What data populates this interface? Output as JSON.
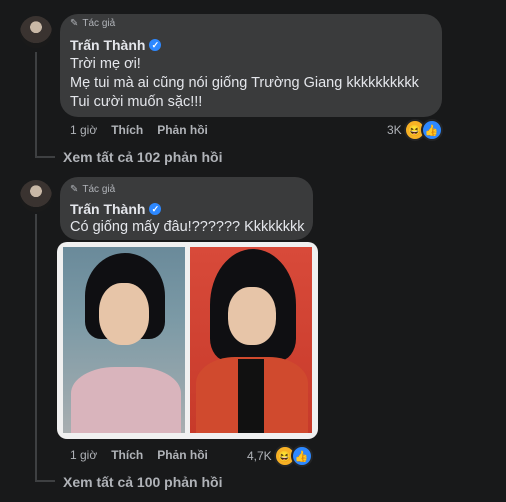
{
  "comments": [
    {
      "author_tag": "Tác giả",
      "author": "Trấn Thành",
      "text_lines": [
        "Trời mẹ ơi!",
        "Mẹ tui mà ai cũng nói giống Trường Giang kkkkkkkkkk",
        "Tui cười muốn sặc!!!"
      ],
      "time": "1 giờ",
      "like_label": "Thích",
      "reply_label": "Phản hồi",
      "reaction_count": "3K",
      "view_replies": "Xem tất cả 102 phản hồi"
    },
    {
      "author_tag": "Tác giả",
      "author": "Trấn Thành",
      "text_lines": [
        "Có giống mấy đâu!?????? Kkkkkkkk"
      ],
      "time": "1 giờ",
      "like_label": "Thích",
      "reply_label": "Phản hồi",
      "reaction_count": "4,7K",
      "view_replies": "Xem tất cả 100 phản hồi"
    }
  ],
  "icons": {
    "pencil": "✎",
    "verified": "✓",
    "haha": "😆",
    "like": "👍"
  }
}
